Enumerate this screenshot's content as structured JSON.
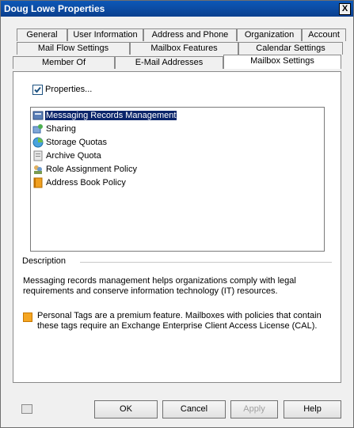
{
  "window": {
    "title": "Doug Lowe Properties",
    "close_glyph": "X"
  },
  "tabs": {
    "row1": [
      "General",
      "User Information",
      "Address and Phone",
      "Organization",
      "Account"
    ],
    "row2": [
      "Mail Flow Settings",
      "Mailbox Features",
      "Calendar Settings"
    ],
    "row3": [
      "Member Of",
      "E-Mail Addresses",
      "Mailbox Settings"
    ],
    "active": "Mailbox Settings"
  },
  "properties_button": {
    "label": "Properties...",
    "checked": true
  },
  "settings_list": {
    "items": [
      {
        "label": "Messaging Records Management",
        "icon": "records-management-icon",
        "selected": true
      },
      {
        "label": "Sharing",
        "icon": "sharing-icon",
        "selected": false
      },
      {
        "label": "Storage Quotas",
        "icon": "storage-quota-icon",
        "selected": false
      },
      {
        "label": "Archive Quota",
        "icon": "archive-quota-icon",
        "selected": false
      },
      {
        "label": "Role Assignment Policy",
        "icon": "role-assignment-icon",
        "selected": false
      },
      {
        "label": "Address Book Policy",
        "icon": "address-book-icon",
        "selected": false
      }
    ]
  },
  "description": {
    "heading": "Description",
    "text": "Messaging records management helps organizations comply with legal requirements and conserve information technology (IT) resources.",
    "note_icon": "premium-feature-icon",
    "note": "Personal Tags are a premium feature. Mailboxes with policies that contain these tags require an Exchange Enterprise Client Access License (CAL)."
  },
  "buttons": {
    "ok": "OK",
    "cancel": "Cancel",
    "apply": "Apply",
    "help": "Help"
  },
  "footer_icon": "command-shell-icon"
}
